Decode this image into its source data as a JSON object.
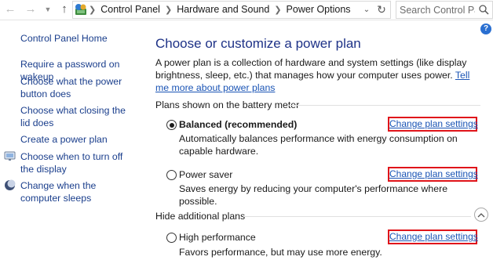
{
  "address_bar": {
    "breadcrumbs": [
      "Control Panel",
      "Hardware and Sound",
      "Power Options"
    ],
    "search_placeholder": "Search Control Pa..."
  },
  "left_pane": {
    "home_label": "Control Panel Home",
    "links": [
      {
        "label": "Require a password on wakeup",
        "has_icon": false
      },
      {
        "label": "Choose what the power button does",
        "has_icon": false
      },
      {
        "label": "Choose what closing the lid does",
        "has_icon": false
      },
      {
        "label": "Create a power plan",
        "has_icon": false
      },
      {
        "label": "Choose when to turn off the display",
        "has_icon": true,
        "icon": "monitor-icon"
      },
      {
        "label": "Change when the computer sleeps",
        "has_icon": true,
        "icon": "moon-icon"
      }
    ]
  },
  "main": {
    "title": "Choose or customize a power plan",
    "intro_text": "A power plan is a collection of hardware and system settings (like display brightness, sleep, etc.) that manages how your computer uses power.",
    "intro_link": "Tell me more about power plans",
    "battery_section_label": "Plans shown on the battery meter",
    "hidden_section_label": "Hide additional plans",
    "change_link_label": "Change plan settings",
    "plans": [
      {
        "name": "Balanced (recommended)",
        "description": "Automatically balances performance with energy consumption on capable hardware.",
        "selected": true
      },
      {
        "name": "Power saver",
        "description": "Saves energy by reducing your computer's performance where possible.",
        "selected": false
      },
      {
        "name": "High performance",
        "description": "Favors performance, but may use more energy.",
        "selected": false
      }
    ]
  },
  "colors": {
    "title_blue": "#1e3287",
    "link_blue": "#1a54b5",
    "highlight_red": "#e0141a"
  }
}
